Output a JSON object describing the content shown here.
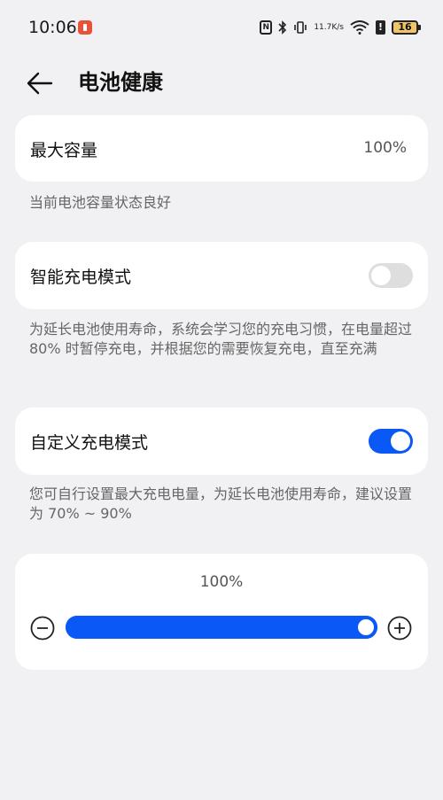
{
  "status_bar": {
    "time": "10:06",
    "net_speed_value": "11.7",
    "net_speed_unit": "K/s",
    "battery_level": "16",
    "icons": [
      "notification-icon",
      "nfc-icon",
      "bluetooth-icon",
      "vibrate-icon",
      "wifi-icon",
      "alert-icon",
      "battery-icon"
    ]
  },
  "header": {
    "title": "电池健康"
  },
  "max_capacity": {
    "label": "最大容量",
    "value": "100%",
    "description": "当前电池容量状态良好"
  },
  "smart_charge": {
    "label": "智能充电模式",
    "enabled": false,
    "description": "为延长电池使用寿命，系统会学习您的充电习惯，在电量超过 80% 时暂停充电，并根据您的需要恢复充电，直至充满"
  },
  "custom_charge": {
    "label": "自定义充电模式",
    "enabled": true,
    "description": "您可自行设置最大充电电量，为延长电池使用寿命，建议设置为 70% ~ 90%"
  },
  "charge_limit": {
    "value_label": "100%",
    "value": 100,
    "min": 0,
    "max": 100
  },
  "colors": {
    "accent": "#0a59f7",
    "background": "#f1f1f3",
    "card": "#ffffff"
  }
}
